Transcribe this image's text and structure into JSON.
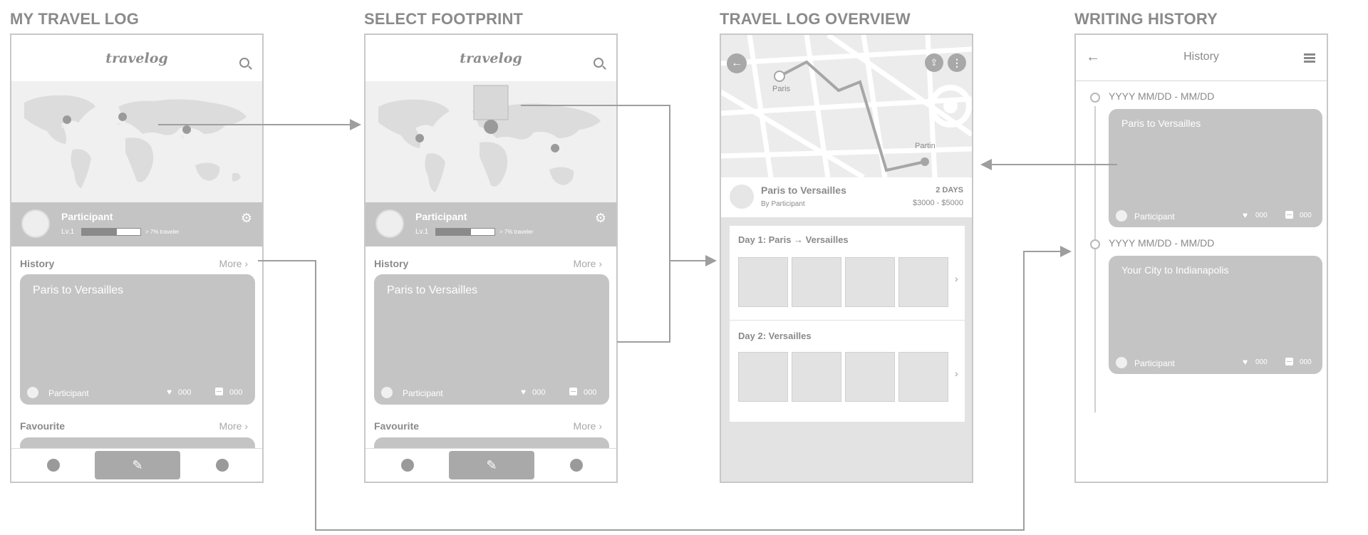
{
  "titles": {
    "screen1": "MY TRAVEL LOG",
    "screen2": "SELECT FOOTPRINT",
    "screen3": "TRAVEL LOG OVERVIEW",
    "screen4": "WRITING HISTORY"
  },
  "app": {
    "logo": "travelog",
    "profile": {
      "name": "Participant",
      "level": "Lv.1",
      "progress_fraction": 0.6,
      "note": "> 7% traveler"
    },
    "history_label": "History",
    "favourite_label": "Favourite",
    "more_label": "More",
    "history_card": {
      "title": "Paris to Versailles",
      "author": "Participant",
      "likes": "000",
      "comments": "000"
    }
  },
  "overview": {
    "map_labels": {
      "start": "Paris",
      "end": "Partin"
    },
    "trip": {
      "title": "Paris to Versailles",
      "by": "By Participant",
      "duration": "2 DAYS",
      "budget": "$3000 - $5000"
    },
    "days": [
      {
        "label": "Day 1: Paris → Versailles"
      },
      {
        "label": "Day 2: Versailles"
      }
    ]
  },
  "history_screen": {
    "header_title": "History",
    "entries": [
      {
        "date": "YYYY MM/DD - MM/DD",
        "title": "Paris to Versailles",
        "author": "Participant",
        "likes": "000",
        "comments": "000"
      },
      {
        "date": "YYYY MM/DD - MM/DD",
        "title": "Your City to Indianapolis",
        "author": "Participant",
        "likes": "000",
        "comments": "000"
      }
    ]
  },
  "icons": {
    "search": "search-icon",
    "gear": "gear-icon",
    "globe": "globe-icon",
    "pencil": "pencil-icon",
    "user": "user-icon",
    "back": "back-arrow-icon",
    "share": "share-icon",
    "more_vert": "more-vertical-icon",
    "list": "list-icon",
    "heart": "heart-icon",
    "comment": "comment-icon",
    "pin": "map-pin-icon",
    "chevron": "chevron-right-icon"
  },
  "colors": {
    "wireframe_gray": "#c4c4c4",
    "text_gray": "#8a8a8a",
    "connector": "#9e9e9e"
  }
}
